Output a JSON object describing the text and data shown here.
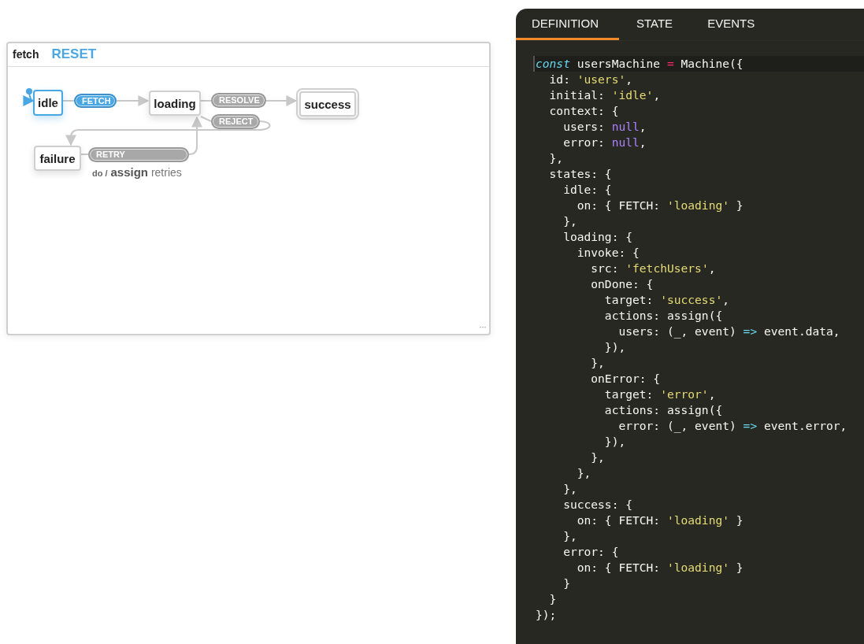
{
  "chart_panel": {
    "title": "fetch",
    "reset": "RESET",
    "more": "···"
  },
  "states": [
    {
      "name": "idle",
      "active": true,
      "initial": true,
      "final": false
    },
    {
      "name": "loading",
      "active": false,
      "initial": false,
      "final": false
    },
    {
      "name": "success",
      "active": false,
      "initial": false,
      "final": true
    },
    {
      "name": "failure",
      "active": false,
      "initial": false,
      "final": false
    }
  ],
  "transitions": [
    {
      "event": "FETCH",
      "enabled": true
    },
    {
      "event": "RESOLVE",
      "enabled": false
    },
    {
      "event": "REJECT",
      "enabled": false
    },
    {
      "event": "RETRY",
      "enabled": false
    }
  ],
  "action": {
    "prefix": "do /",
    "name": "assign",
    "detail": "retries"
  },
  "tabs": [
    {
      "label": "DEFINITION",
      "selected": true
    },
    {
      "label": "STATE",
      "selected": false
    },
    {
      "label": "EVENTS",
      "selected": false
    }
  ],
  "code": [
    [
      {
        "kind": "keyword",
        "text": "const"
      },
      {
        "kind": "plain",
        "text": " usersMachine "
      },
      {
        "kind": "op",
        "text": "="
      },
      {
        "kind": "plain",
        "text": " Machine({"
      }
    ],
    [
      {
        "kind": "plain",
        "text": "  id: "
      },
      {
        "kind": "string",
        "text": "'users'"
      },
      {
        "kind": "plain",
        "text": ","
      }
    ],
    [
      {
        "kind": "plain",
        "text": "  initial: "
      },
      {
        "kind": "string",
        "text": "'idle'"
      },
      {
        "kind": "plain",
        "text": ","
      }
    ],
    [
      {
        "kind": "plain",
        "text": "  context: {"
      }
    ],
    [
      {
        "kind": "plain",
        "text": "    users: "
      },
      {
        "kind": "null",
        "text": "null"
      },
      {
        "kind": "plain",
        "text": ","
      }
    ],
    [
      {
        "kind": "plain",
        "text": "    error: "
      },
      {
        "kind": "null",
        "text": "null"
      },
      {
        "kind": "plain",
        "text": ","
      }
    ],
    [
      {
        "kind": "plain",
        "text": "  },"
      }
    ],
    [
      {
        "kind": "plain",
        "text": "  states: {"
      }
    ],
    [
      {
        "kind": "plain",
        "text": "    idle: {"
      }
    ],
    [
      {
        "kind": "plain",
        "text": "      on: { FETCH: "
      },
      {
        "kind": "string",
        "text": "'loading'"
      },
      {
        "kind": "plain",
        "text": " }"
      }
    ],
    [
      {
        "kind": "plain",
        "text": "    },"
      }
    ],
    [
      {
        "kind": "plain",
        "text": "    loading: {"
      }
    ],
    [
      {
        "kind": "plain",
        "text": "      invoke: {"
      }
    ],
    [
      {
        "kind": "plain",
        "text": "        src: "
      },
      {
        "kind": "string",
        "text": "'fetchUsers'"
      },
      {
        "kind": "plain",
        "text": ","
      }
    ],
    [
      {
        "kind": "plain",
        "text": "        onDone: {"
      }
    ],
    [
      {
        "kind": "plain",
        "text": "          target: "
      },
      {
        "kind": "string",
        "text": "'success'"
      },
      {
        "kind": "plain",
        "text": ","
      }
    ],
    [
      {
        "kind": "plain",
        "text": "          actions: assign({"
      }
    ],
    [
      {
        "kind": "plain",
        "text": "            users: (_, event) "
      },
      {
        "kind": "arrow",
        "text": "=>"
      },
      {
        "kind": "plain",
        "text": " event.data,"
      }
    ],
    [
      {
        "kind": "plain",
        "text": "          }),"
      }
    ],
    [
      {
        "kind": "plain",
        "text": "        },"
      }
    ],
    [
      {
        "kind": "plain",
        "text": "        onError: {"
      }
    ],
    [
      {
        "kind": "plain",
        "text": "          target: "
      },
      {
        "kind": "string",
        "text": "'error'"
      },
      {
        "kind": "plain",
        "text": ","
      }
    ],
    [
      {
        "kind": "plain",
        "text": "          actions: assign({"
      }
    ],
    [
      {
        "kind": "plain",
        "text": "            error: (_, event) "
      },
      {
        "kind": "arrow",
        "text": "=>"
      },
      {
        "kind": "plain",
        "text": " event.error,"
      }
    ],
    [
      {
        "kind": "plain",
        "text": "          }),"
      }
    ],
    [
      {
        "kind": "plain",
        "text": "        },"
      }
    ],
    [
      {
        "kind": "plain",
        "text": "      },"
      }
    ],
    [
      {
        "kind": "plain",
        "text": "    },"
      }
    ],
    [
      {
        "kind": "plain",
        "text": "    success: {"
      }
    ],
    [
      {
        "kind": "plain",
        "text": "      on: { FETCH: "
      },
      {
        "kind": "string",
        "text": "'loading'"
      },
      {
        "kind": "plain",
        "text": " }"
      }
    ],
    [
      {
        "kind": "plain",
        "text": "    },"
      }
    ],
    [
      {
        "kind": "plain",
        "text": "    error: {"
      }
    ],
    [
      {
        "kind": "plain",
        "text": "      on: { FETCH: "
      },
      {
        "kind": "string",
        "text": "'loading'"
      },
      {
        "kind": "plain",
        "text": " }"
      }
    ],
    [
      {
        "kind": "plain",
        "text": "    }"
      }
    ],
    [
      {
        "kind": "plain",
        "text": "  }"
      }
    ],
    [
      {
        "kind": "plain",
        "text": "});"
      }
    ]
  ]
}
